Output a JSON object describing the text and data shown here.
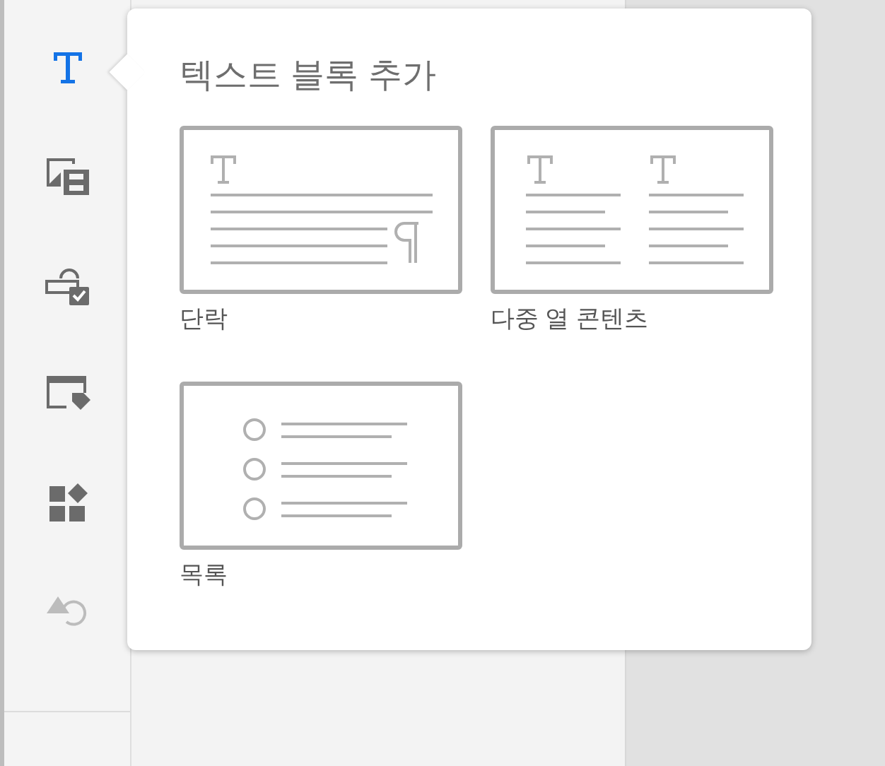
{
  "sidebar": {
    "items": [
      {
        "kind": "text",
        "selected": true,
        "disabled": false
      },
      {
        "kind": "media",
        "selected": false,
        "disabled": false
      },
      {
        "kind": "form",
        "selected": false,
        "disabled": false
      },
      {
        "kind": "tag",
        "selected": false,
        "disabled": false
      },
      {
        "kind": "widgets",
        "selected": false,
        "disabled": false
      },
      {
        "kind": "restore",
        "selected": false,
        "disabled": true
      }
    ]
  },
  "popover": {
    "title": "텍스트 블록 추가",
    "blocks": [
      {
        "kind": "paragraph",
        "label": "단락"
      },
      {
        "kind": "columns",
        "label": "다중 열 콘텐츠"
      },
      {
        "kind": "list",
        "label": "목록"
      }
    ]
  }
}
